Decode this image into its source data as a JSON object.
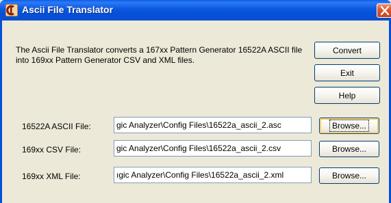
{
  "window": {
    "title": "Ascii File Translator",
    "icons": {
      "app": "logic-analyzer-app-icon",
      "close": "close-icon"
    },
    "colors": {
      "titlebar": "#0550D8",
      "face": "#ECE9D8",
      "close": "#E05D32"
    }
  },
  "description": "The Ascii File Translator converts a 167xx Pattern Generator 16522A ASCII file into 169xx Pattern Generator CSV and XML files.",
  "buttons": {
    "convert": "Convert",
    "exit": "Exit",
    "help": "Help"
  },
  "files": [
    {
      "label": "16522A ASCII File:",
      "value": "gic Analyzer\\Config Files\\16522a_ascii_2.asc",
      "browse": "Browse..."
    },
    {
      "label": "169xx CSV File:",
      "value": "gic Analyzer\\Config Files\\16522a_ascii_2.csv",
      "browse": "Browse..."
    },
    {
      "label": "169xx XML File:",
      "value": "ıgic Analyzer\\Config Files\\16522a_ascii_2.xml",
      "browse": "Browse..."
    }
  ]
}
